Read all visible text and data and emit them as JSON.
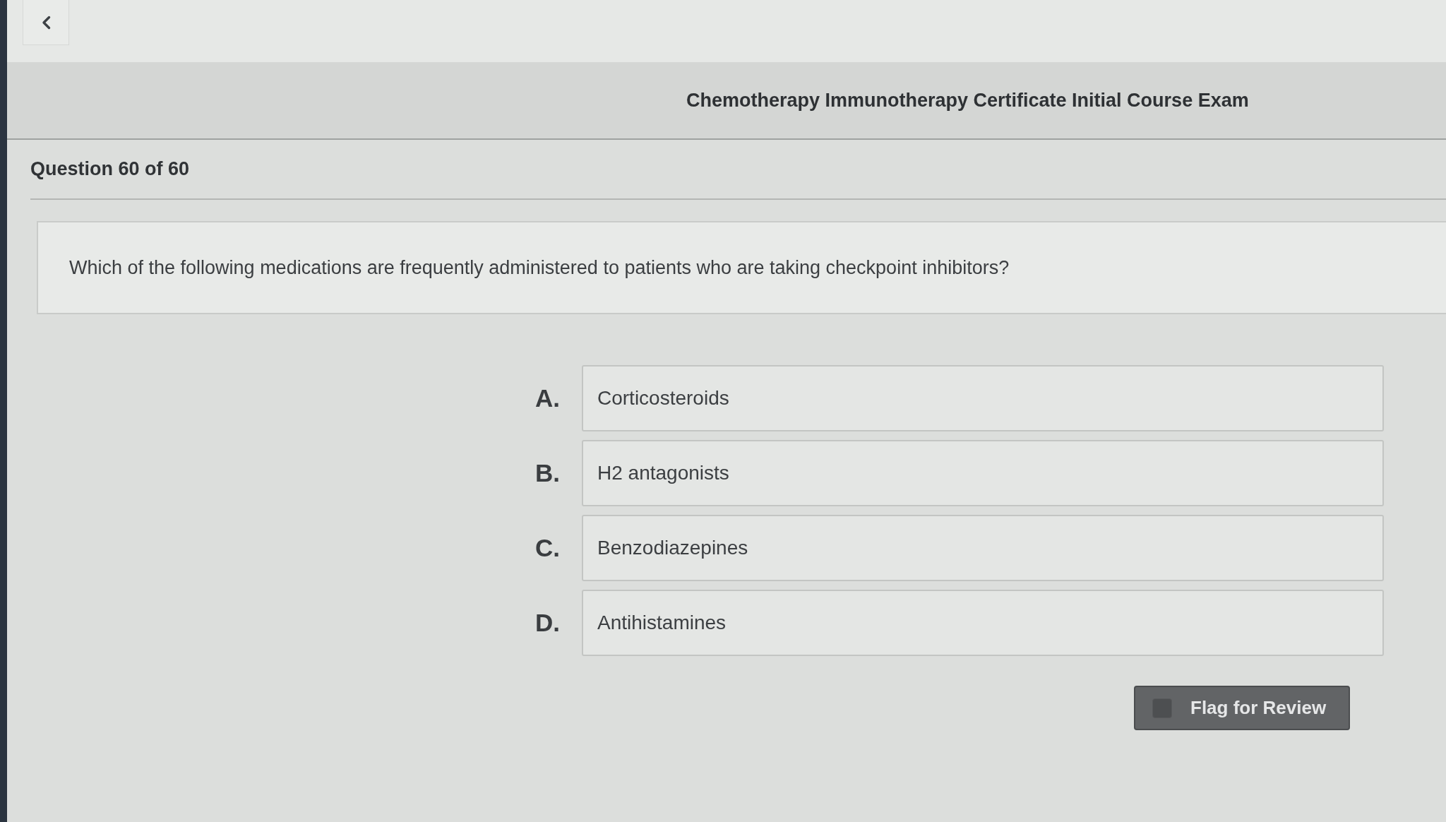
{
  "exam_title": "Chemotherapy Immunotherapy Certificate Initial Course Exam",
  "question_counter": "Question 60 of 60",
  "question": {
    "text": "Which of the following medications are frequently administered to patients who are taking checkpoint inhibitors?"
  },
  "options": [
    {
      "letter": "A.",
      "text": "Corticosteroids",
      "selected": false
    },
    {
      "letter": "B.",
      "text": "H2 antagonists",
      "selected": false
    },
    {
      "letter": "C.",
      "text": "Benzodiazepines",
      "selected": false
    },
    {
      "letter": "D.",
      "text": "Antihistamines",
      "selected": false
    }
  ],
  "flag_for_review": {
    "label": "Flag for Review",
    "checked": false
  }
}
